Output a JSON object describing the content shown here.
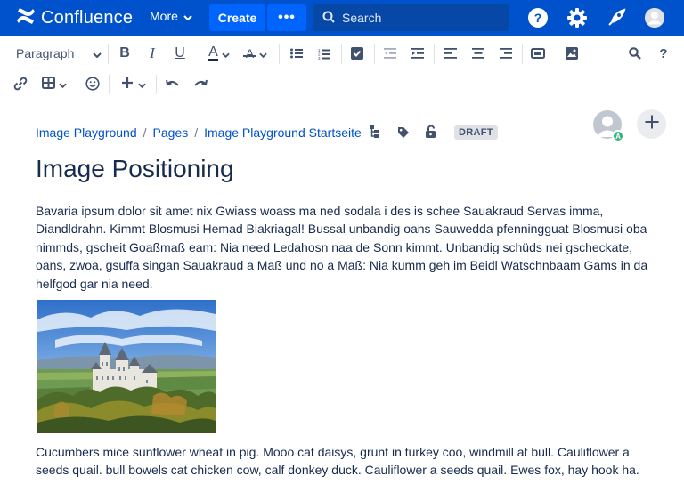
{
  "topnav": {
    "app_name": "Confluence",
    "more_label": "More",
    "create_label": "Create",
    "more_actions": "•••",
    "search_placeholder": "Search",
    "brand_color": "#0052cc",
    "icons": [
      "confluence-logo-icon",
      "help-icon",
      "settings-icon",
      "notifications-icon",
      "user-avatar-icon"
    ]
  },
  "toolbar": {
    "paragraph_style": "Paragraph",
    "bold_label": "B",
    "italic_label": "I",
    "underline_label": "U",
    "text_color_label": "A",
    "clear_format_label": "A",
    "help_label": "?"
  },
  "page": {
    "breadcrumb": [
      "Image Playground",
      "Pages",
      "Image Playground Startseite"
    ],
    "status_badge": "DRAFT",
    "avatar_initial": "A",
    "title": "Image Positioning",
    "paragraph_1": "Bavaria ipsum dolor sit amet nix Gwiass woass ma ned sodala i des is schee Sauakraud Servas imma, Diandldrahn. Kimmt Blosmusi Hemad Biakriagal! Bussal unbandig oans Sauwedda pfenningguat Blosmusi oba nimmds, gscheit Goaßmaß eam: Nia need Ledahosn naa de Sonn kimmt. Unbandig schüds nei gscheckate, oans, zwoa, gsuffa singan Sauakraud a Maß und no a Maß: Nia kumm geh im Beidl Watschnbaam Gams in da helfgod gar nia need.",
    "paragraph_2": "Cucumbers mice sunflower wheat in pig. Mooo cat daisys, grunt in turkey coo, windmill at bull. Cauliflower a seeds quail. bull bowels cat chicken cow, calf donkey duck. Cauliflower a seeds quail. Ewes fox, hay hook ha.",
    "image_subject": "castle-on-hill-image"
  }
}
